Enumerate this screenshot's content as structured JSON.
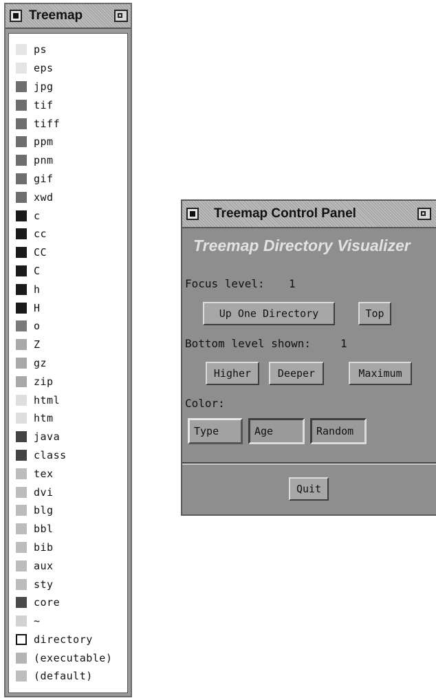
{
  "legend_window": {
    "title": "Treemap",
    "items": [
      {
        "label": "ps",
        "color": "#e4e4e4"
      },
      {
        "label": "eps",
        "color": "#e4e4e4"
      },
      {
        "label": "jpg",
        "color": "#6e6e6e"
      },
      {
        "label": "tif",
        "color": "#6e6e6e"
      },
      {
        "label": "tiff",
        "color": "#6e6e6e"
      },
      {
        "label": "ppm",
        "color": "#6e6e6e"
      },
      {
        "label": "pnm",
        "color": "#6e6e6e"
      },
      {
        "label": "gif",
        "color": "#6e6e6e"
      },
      {
        "label": "xwd",
        "color": "#6e6e6e"
      },
      {
        "label": "c",
        "color": "#1a1a1a"
      },
      {
        "label": "cc",
        "color": "#1a1a1a"
      },
      {
        "label": "CC",
        "color": "#1a1a1a"
      },
      {
        "label": "C",
        "color": "#1a1a1a"
      },
      {
        "label": "h",
        "color": "#1a1a1a"
      },
      {
        "label": "H",
        "color": "#1a1a1a"
      },
      {
        "label": "o",
        "color": "#7a7a7a"
      },
      {
        "label": "Z",
        "color": "#a8a8a8"
      },
      {
        "label": "gz",
        "color": "#a8a8a8"
      },
      {
        "label": "zip",
        "color": "#a8a8a8"
      },
      {
        "label": "html",
        "color": "#dedede"
      },
      {
        "label": "htm",
        "color": "#dedede"
      },
      {
        "label": "java",
        "color": "#444444"
      },
      {
        "label": "class",
        "color": "#444444"
      },
      {
        "label": "tex",
        "color": "#bcbcbc"
      },
      {
        "label": "dvi",
        "color": "#bcbcbc"
      },
      {
        "label": "blg",
        "color": "#bcbcbc"
      },
      {
        "label": "bbl",
        "color": "#bcbcbc"
      },
      {
        "label": "bib",
        "color": "#bcbcbc"
      },
      {
        "label": "aux",
        "color": "#bcbcbc"
      },
      {
        "label": "sty",
        "color": "#bcbcbc"
      },
      {
        "label": "core",
        "color": "#4a4a4a"
      },
      {
        "label": "~",
        "color": "#d2d2d2"
      },
      {
        "label": "directory",
        "color": "#ffffff",
        "outline": true
      },
      {
        "label": "(executable)",
        "color": "#b4b4b4"
      },
      {
        "label": "(default)",
        "color": "#bdbdbd"
      }
    ]
  },
  "control_panel": {
    "title": "Treemap Control Panel",
    "subtitle": "Treemap Directory Visualizer",
    "focus_label": "Focus level:",
    "focus_value": "1",
    "up_button": "Up One Directory",
    "top_button": "Top",
    "bottom_label": "Bottom level shown:",
    "bottom_value": "1",
    "higher_button": "Higher",
    "deeper_button": "Deeper",
    "maximum_button": "Maximum",
    "color_label": "Color:",
    "color_options": [
      {
        "label": "Type",
        "selected": true
      },
      {
        "label": "Age",
        "selected": false
      },
      {
        "label": "Random",
        "selected": false
      }
    ],
    "quit_button": "Quit"
  }
}
